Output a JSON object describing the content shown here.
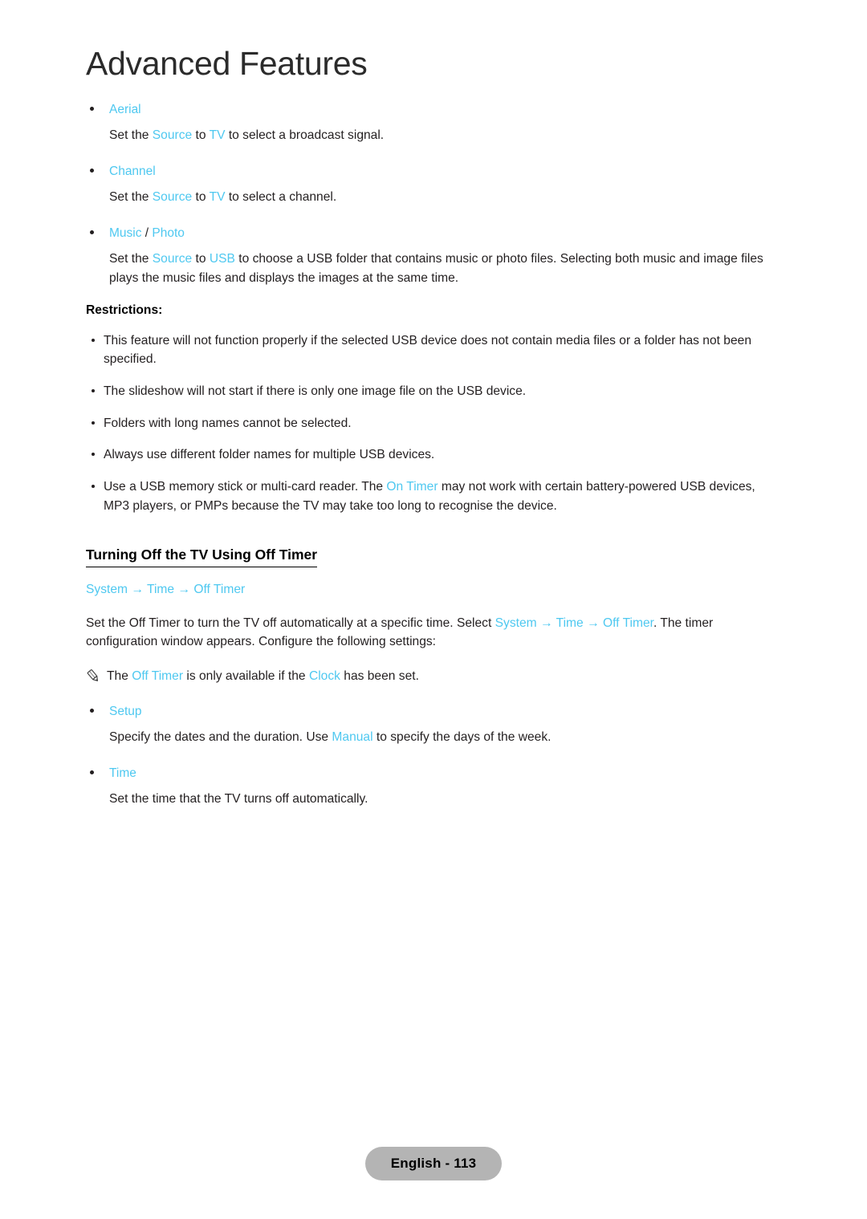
{
  "page": {
    "title": "Advanced Features",
    "accent_color": "#4ec8f0",
    "text_color": "#231f20",
    "footer_badge_color": "#b4b4b4"
  },
  "source_items": [
    {
      "label": "Aerial",
      "separator": "",
      "label2": "",
      "body_pre": "Set the ",
      "body_k1": "Source",
      "body_mid": " to ",
      "body_k2": "TV",
      "body_post": " to select a broadcast signal."
    },
    {
      "label": "Channel",
      "separator": "",
      "label2": "",
      "body_pre": "Set the ",
      "body_k1": "Source",
      "body_mid": " to ",
      "body_k2": "TV",
      "body_post": " to select a channel."
    },
    {
      "label": "Music",
      "separator": " / ",
      "label2": "Photo",
      "body_pre": "Set the ",
      "body_k1": "Source",
      "body_mid": " to ",
      "body_k2": "USB",
      "body_post": " to choose a USB folder that contains music or photo files. Selecting both music and image files plays the music files and displays the images at the same time."
    }
  ],
  "restrictions": {
    "label": "Restrictions:",
    "items": [
      {
        "pre": "This feature will not function properly if the selected USB device does not contain media files or a folder has not been specified.",
        "key": "",
        "post": ""
      },
      {
        "pre": "The slideshow will not start if there is only one image file on the USB device.",
        "key": "",
        "post": ""
      },
      {
        "pre": "Folders with long names cannot be selected.",
        "key": "",
        "post": ""
      },
      {
        "pre": "Always use different folder names for multiple USB devices.",
        "key": "",
        "post": ""
      },
      {
        "pre": "Use a USB memory stick or multi-card reader. The ",
        "key": "On Timer",
        "post": " may not work with certain battery-powered USB devices, MP3 players, or PMPs because the TV may take too long to recognise the device."
      }
    ]
  },
  "off_timer_section": {
    "heading": "Turning Off the TV Using Off Timer",
    "breadcrumb": {
      "item1": "System",
      "arrow1": "→",
      "item2": "Time",
      "arrow2": "→",
      "item3": "Off Timer"
    },
    "intro": {
      "pre": "Set the Off Timer to turn the TV off automatically at a specific time. Select ",
      "c1": "System",
      "a1": "→",
      "c2": "Time",
      "a2": "→",
      "c3": "Off Timer",
      "post": ". The timer configuration window appears. Configure the following settings:"
    },
    "note": {
      "icon": "pencil-note-icon",
      "pre": "The ",
      "k1": "Off Timer",
      "mid": " is only available if the ",
      "k2": "Clock",
      "post": "  has been set."
    },
    "items": [
      {
        "label": "Setup",
        "body_pre": "Specify the dates and the duration. Use ",
        "body_key": "Manual",
        "body_post": " to specify the days of the week."
      },
      {
        "label": "Time",
        "body_pre": "Set the time that the TV turns off automatically.",
        "body_key": "",
        "body_post": ""
      }
    ]
  },
  "footer": {
    "badge": "English - 113"
  }
}
